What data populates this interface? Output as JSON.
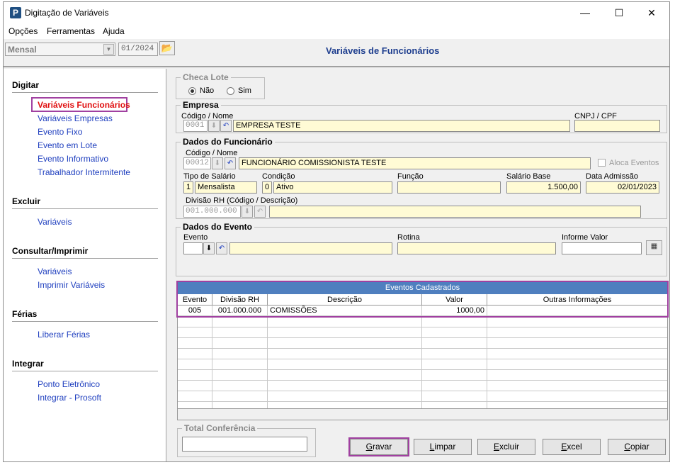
{
  "window": {
    "title": "Digitação de Variáveis",
    "app_icon": "P",
    "minimize": "—",
    "maximize": "☐",
    "close": "✕"
  },
  "menu": {
    "items": [
      "Opções",
      "Ferramentas",
      "Ajuda"
    ]
  },
  "toolbar": {
    "period_type": "Mensal",
    "period": "01/2024",
    "page_title": "Variáveis de Funcionários"
  },
  "sidebar": {
    "digitar": {
      "title": "Digitar",
      "items": [
        "Variáveis Funcionários",
        "Variáveis Empresas",
        "Evento Fixo",
        "Evento em Lote",
        "Evento Informativo",
        "Trabalhador Intermitente"
      ]
    },
    "excluir": {
      "title": "Excluir",
      "items": [
        "Variáveis"
      ]
    },
    "consultar": {
      "title": "Consultar/Imprimir",
      "items": [
        "Variáveis",
        "Imprimir Variáveis"
      ]
    },
    "ferias": {
      "title": "Férias",
      "items": [
        "Liberar Férias"
      ]
    },
    "integrar": {
      "title": "Integrar",
      "items": [
        "Ponto Eletrônico",
        "Integrar - Prosoft"
      ]
    }
  },
  "checa_lote": {
    "title": "Checa Lote",
    "option_no": "Não",
    "option_yes": "Sim",
    "selected": "Não"
  },
  "empresa": {
    "title": "Empresa",
    "code_label": "Código / Nome",
    "code": "0001",
    "name": "EMPRESA TESTE",
    "cnpj_label": "CNPJ / CPF",
    "cnpj": ""
  },
  "funcionario": {
    "title": "Dados do Funcionário",
    "code_label": "Código / Nome",
    "code": "00012",
    "name": "FUNCIONÁRIO COMISSIONISTA TESTE",
    "aloca_label": "Aloca Eventos",
    "tipo_label": "Tipo de Salário",
    "tipo_code": "1",
    "tipo": "Mensalista",
    "condicao_label": "Condição",
    "condicao_code": "0",
    "condicao": "Ativo",
    "funcao_label": "Função",
    "funcao": "",
    "salario_label": "Salário Base",
    "salario": "1.500,00",
    "admissao_label": "Data Admissão",
    "admissao": "02/01/2023",
    "divisao_label": "Divisão RH (Código / Descrição)",
    "divisao_code": "001.000.000",
    "divisao": ""
  },
  "evento": {
    "title": "Dados do Evento",
    "evento_label": "Evento",
    "rotina_label": "Rotina",
    "valor_label": "Informe Valor"
  },
  "grid": {
    "caption": "Eventos Cadastrados",
    "columns": [
      "Evento",
      "Divisão RH",
      "Descrição",
      "Valor",
      "Outras Informações"
    ],
    "rows": [
      [
        "005",
        "001.000.000",
        "COMISSÕES",
        "1000,00",
        ""
      ]
    ]
  },
  "total": {
    "title": "Total Conferência",
    "value": ""
  },
  "buttons": {
    "gravar_key": "G",
    "gravar_rest": "ravar",
    "limpar_key": "L",
    "limpar_rest": "impar",
    "excluir_key": "E",
    "excluir_rest": "xcluir",
    "excel_key": "E",
    "excel_rest": "xcel",
    "copiar_key": "C",
    "copiar_rest": "opiar"
  },
  "colors": {
    "accent": "#1f3f8f",
    "link": "#1f3fbf",
    "active_link": "#e01010",
    "highlight": "#a040a0",
    "field_bg": "#fffbd5"
  }
}
